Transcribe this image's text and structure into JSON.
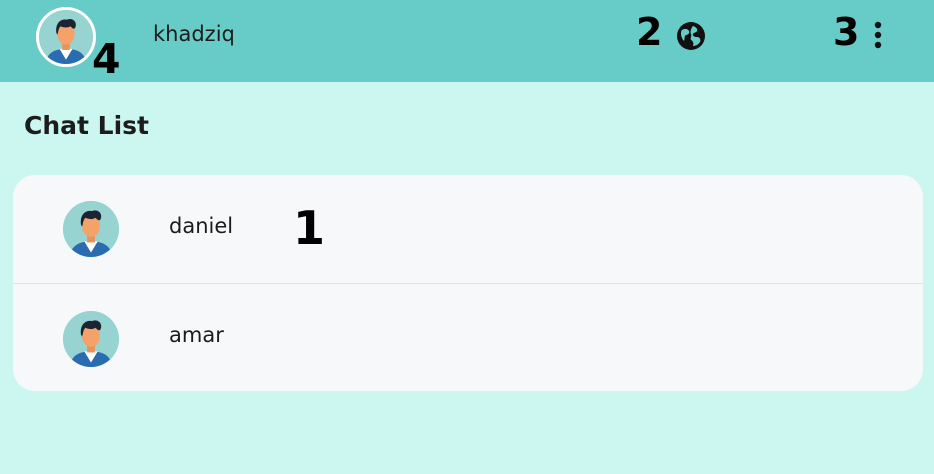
{
  "header": {
    "username": "khadziq",
    "profile_avatar_icon": "user-avatar-icon",
    "language_icon": "globe-icon",
    "menu_icon": "more-vertical-icon",
    "background_color": "#67ccc8"
  },
  "markers": {
    "profile": "4",
    "language": "2",
    "menu": "3",
    "chat": "1"
  },
  "page": {
    "title": "Chat List",
    "background_color": "#ccf7f1"
  },
  "chats": [
    {
      "name": "daniel",
      "avatar_icon": "user-avatar-icon"
    },
    {
      "name": "amar",
      "avatar_icon": "user-avatar-icon"
    }
  ]
}
